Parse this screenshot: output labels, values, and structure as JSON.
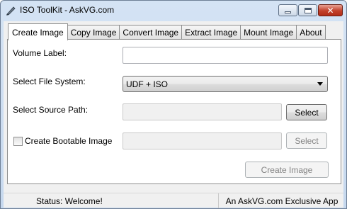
{
  "window": {
    "title": "ISO ToolKit - AskVG.com",
    "icon": "iso-toolkit-icon",
    "controls": {
      "minimize": "minimize-icon",
      "maximize": "maximize-icon",
      "close": "close-icon"
    }
  },
  "tabs": [
    {
      "label": "Create Image",
      "active": true
    },
    {
      "label": "Copy Image",
      "active": false
    },
    {
      "label": "Convert Image",
      "active": false
    },
    {
      "label": "Extract Image",
      "active": false
    },
    {
      "label": "Mount Image",
      "active": false
    },
    {
      "label": "About",
      "active": false
    }
  ],
  "form": {
    "volume_label": {
      "label": "Volume Label:",
      "value": ""
    },
    "file_system": {
      "label": "Select File System:",
      "value": "UDF + ISO"
    },
    "source_path": {
      "label": "Select Source Path:",
      "value": "",
      "button": "Select"
    },
    "bootable": {
      "label": "Create Bootable Image",
      "checked": false,
      "value": "",
      "button": "Select"
    },
    "create_button": "Create Image"
  },
  "status": {
    "left": "Status: Welcome!",
    "right": "An AskVG.com Exclusive App"
  }
}
